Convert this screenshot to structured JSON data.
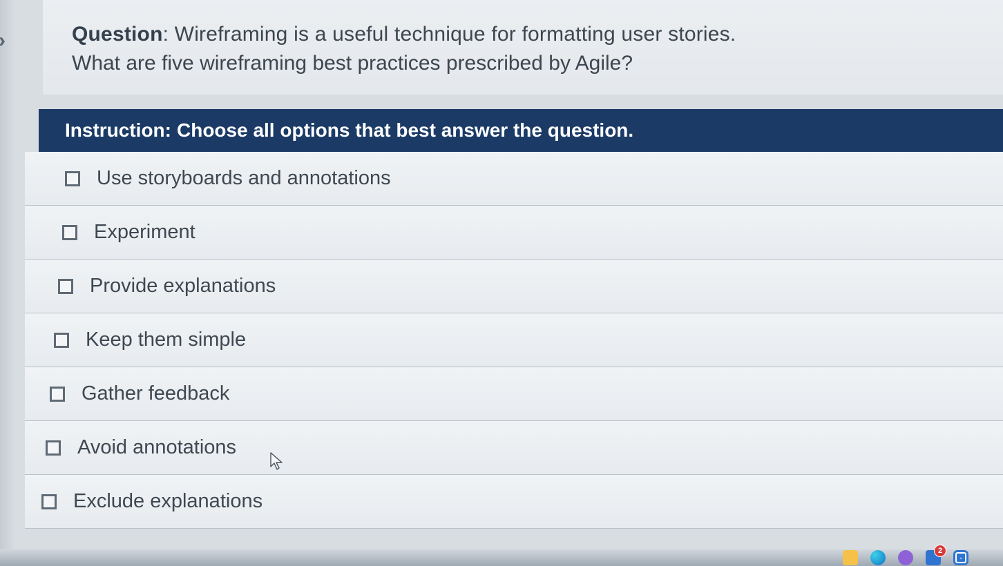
{
  "nav": {
    "chevron": "›"
  },
  "question": {
    "label": "Question",
    "line1": ": Wireframing is a useful technique for formatting user stories.",
    "line2": "What are five wireframing best practices prescribed by Agile?"
  },
  "instruction": {
    "label": "Instruction:",
    "text": "Choose all options that best answer the question."
  },
  "options": [
    {
      "label": "Use storyboards and annotations"
    },
    {
      "label": "Experiment"
    },
    {
      "label": "Provide explanations"
    },
    {
      "label": "Keep them simple"
    },
    {
      "label": "Gather feedback"
    },
    {
      "label": "Avoid annotations"
    },
    {
      "label": "Exclude explanations"
    }
  ],
  "taskbar": {
    "badge": "2"
  }
}
